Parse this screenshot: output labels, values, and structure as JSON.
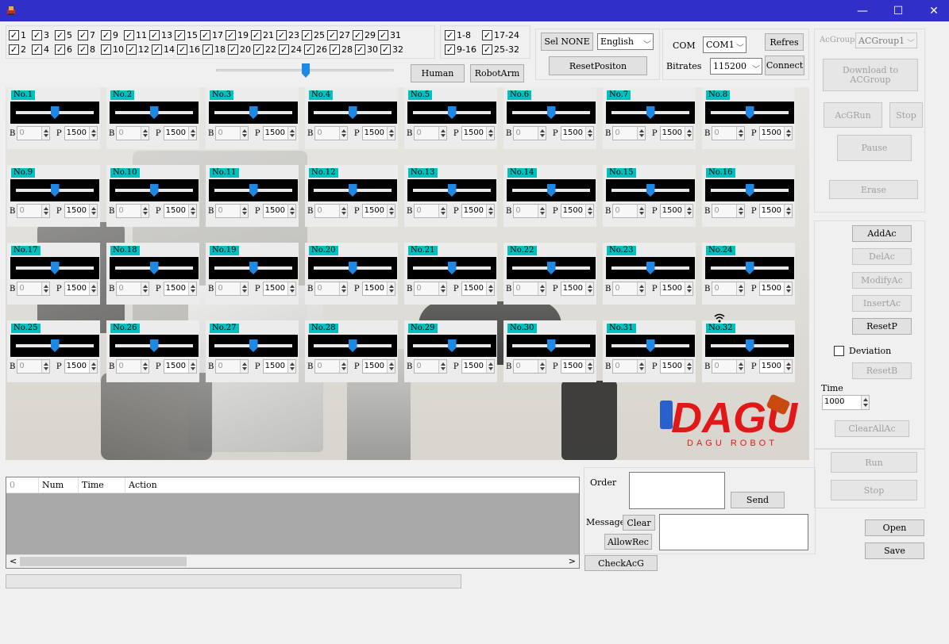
{
  "window": {
    "minimize": "—",
    "maximize": "☐",
    "close": "✕"
  },
  "checkboxes": {
    "row1": [
      "1",
      "3",
      "5",
      "7",
      "9",
      "11",
      "13",
      "15",
      "17",
      "19",
      "21",
      "23",
      "25",
      "27",
      "29",
      "31"
    ],
    "row2": [
      "2",
      "4",
      "6",
      "8",
      "10",
      "12",
      "14",
      "16",
      "18",
      "20",
      "22",
      "24",
      "26",
      "28",
      "30",
      "32"
    ],
    "ranges": [
      "1-8",
      "17-24",
      "9-16",
      "25-32"
    ]
  },
  "buttons": {
    "sel_none": "Sel NONE",
    "reset_position": "ResetPositon",
    "human": "Human",
    "robot_arm": "RobotArm"
  },
  "language": {
    "selected": "English"
  },
  "com": {
    "label": "COM",
    "selected": "COM1",
    "refresh": "Refres",
    "bitrates_label": "Bitrates",
    "bitrate": "115200",
    "connect": "Connect"
  },
  "acgroup": {
    "label": "AcGroup",
    "selected": "ACGroup1",
    "download": "Download to ACGroup",
    "acrun": "AcGRun",
    "stop": "Stop",
    "pause": "Pause",
    "erase": "Erase"
  },
  "actions": {
    "add": "AddAc",
    "del": "DelAc",
    "modify": "ModifyAc",
    "insert": "InsertAc",
    "resetp": "ResetP",
    "deviation": "Deviation",
    "resetb": "ResetB",
    "time_label": "Time",
    "time_value": "1000",
    "clear_all": "ClearAllAc"
  },
  "run": {
    "run": "Run",
    "stop": "Stop"
  },
  "file": {
    "open": "Open",
    "save": "Save"
  },
  "servos": {
    "b_label": "B",
    "p_label": "P",
    "b_value": "0",
    "p_value": "1500",
    "names": [
      "No.1",
      "No.2",
      "No.3",
      "No.4",
      "No.5",
      "No.6",
      "No.7",
      "No.8",
      "No.9",
      "No.10",
      "No.11",
      "No.12",
      "No.13",
      "No.14",
      "No.15",
      "No.16",
      "No.17",
      "No.18",
      "No.19",
      "No.20",
      "No.21",
      "No.22",
      "No.23",
      "No.24",
      "No.25",
      "No.26",
      "No.27",
      "No.28",
      "No.29",
      "No.30",
      "No.31",
      "No.32"
    ],
    "slider_fraction": 0.5
  },
  "table": {
    "columns": [
      "0",
      "Num",
      "Time",
      "Action"
    ]
  },
  "comm": {
    "order_label": "Order",
    "send": "Send",
    "message_label": "Message",
    "clear": "Clear",
    "allow_rec": "AllowRec",
    "check_acg": "CheckAcG"
  },
  "logo": {
    "text": "DAGU",
    "subtext": "DAGU ROBOT"
  },
  "colors": {
    "titlebar": "#3030c8",
    "servo_label": "#00c0c0",
    "thumb": "#1e88e5",
    "logo_red": "#e01818"
  }
}
